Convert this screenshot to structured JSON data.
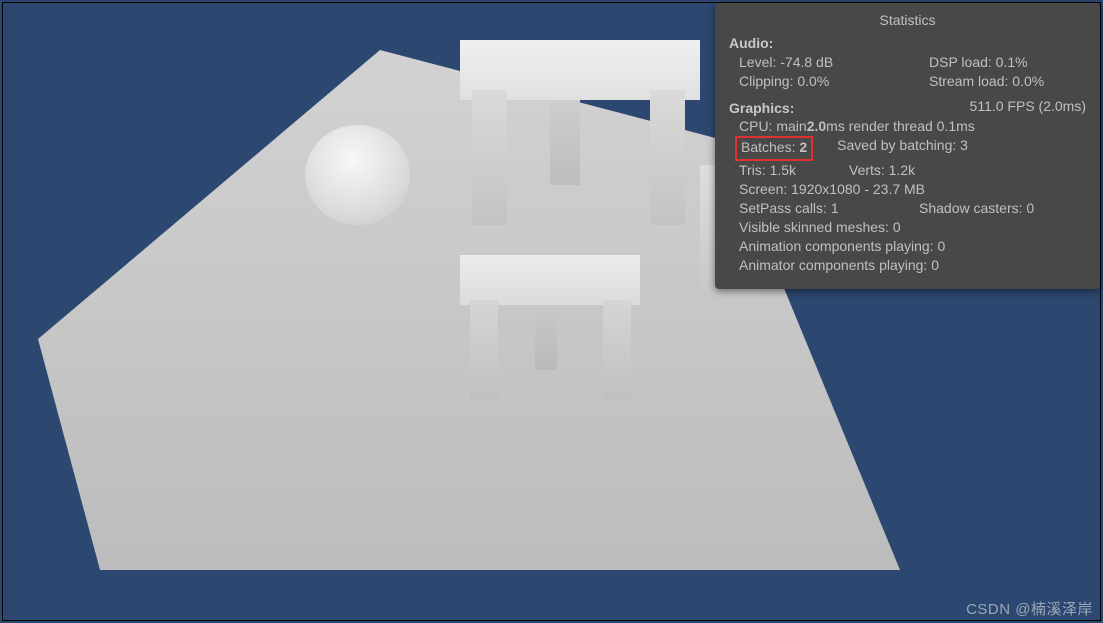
{
  "stats": {
    "title": "Statistics",
    "audio": {
      "heading": "Audio:",
      "level": "Level: -74.8 dB",
      "dsp_load": "DSP load: 0.1%",
      "clipping": "Clipping: 0.0%",
      "stream_load": "Stream load: 0.0%"
    },
    "graphics": {
      "heading": "Graphics:",
      "fps": "511.0 FPS (2.0ms)",
      "cpu_main_prefix": "CPU: main ",
      "cpu_main_value": "2.0",
      "cpu_main_suffix": "ms  render thread 0.1ms",
      "batches_label": "Batches: ",
      "batches_value": "2",
      "saved_by_batching": "Saved by batching: 3",
      "tris": "Tris: 1.5k",
      "verts": "Verts: 1.2k",
      "screen": "Screen: 1920x1080 - 23.7 MB",
      "setpass": "SetPass calls: 1",
      "shadow_casters": "Shadow casters: 0",
      "visible_skinned": "Visible skinned meshes: 0",
      "anim_components": "Animation components playing: 0",
      "animator_components": "Animator components playing: 0"
    }
  },
  "watermark": "CSDN @楠溪泽岸"
}
